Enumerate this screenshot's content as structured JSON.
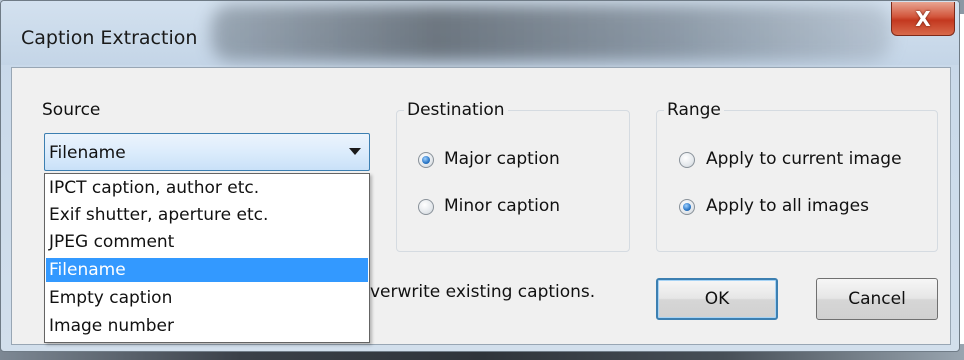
{
  "dialog": {
    "title": "Caption Extraction",
    "close_glyph": "X"
  },
  "source": {
    "label": "Source",
    "selected": "Filename",
    "options": [
      "IPCT caption, author etc.",
      "Exif shutter, aperture etc.",
      "JPEG comment",
      "Filename",
      "Empty caption",
      "Image number"
    ],
    "highlighted_index": 3
  },
  "destination": {
    "label": "Destination",
    "options": [
      {
        "label": "Major caption",
        "checked": true
      },
      {
        "label": "Minor caption",
        "checked": false
      }
    ]
  },
  "range": {
    "label": "Range",
    "options": [
      {
        "label": "Apply to current image",
        "checked": false
      },
      {
        "label": "Apply to all images",
        "checked": true
      }
    ]
  },
  "note_fragment": "verwrite existing captions.",
  "buttons": {
    "ok": "OK",
    "cancel": "Cancel"
  },
  "colors": {
    "highlight": "#3399ff",
    "close_button": "#c3381f"
  }
}
